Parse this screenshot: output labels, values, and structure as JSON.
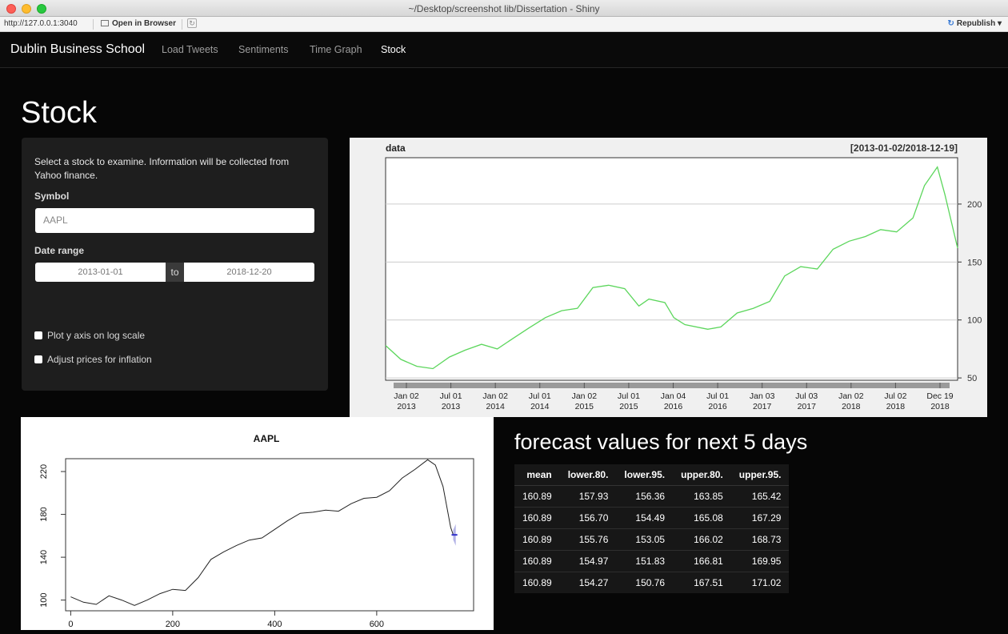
{
  "window": {
    "title": "~/Desktop/screenshot lib/Dissertation - Shiny",
    "url": "http://127.0.0.1:3040",
    "open_in_browser": "Open in Browser",
    "republish": "Republish"
  },
  "nav": {
    "brand": "Dublin Business School",
    "items": [
      "Load Tweets",
      "Sentiments",
      "Time Graph",
      "Stock"
    ],
    "active": "Stock"
  },
  "page": {
    "title": "Stock"
  },
  "sidebar": {
    "help_text": "Select a stock to examine. Information will be collected from Yahoo finance.",
    "symbol_label": "Symbol",
    "symbol_value": "AAPL",
    "date_label": "Date range",
    "date_from": "2013-01-01",
    "date_sep": "to",
    "date_to": "2018-12-20",
    "checkbox_log": "Plot y axis on log scale",
    "checkbox_inflation": "Adjust prices for inflation"
  },
  "colors": {
    "price_line": "#5cd65c",
    "forecast": "#3333cc",
    "forecast_band": "#b3b3e6"
  },
  "chart_data": [
    {
      "type": "line",
      "title": "data",
      "subtitle": "[2013-01-02/2018-12-19]",
      "x_ticks": [
        "Jan 02\n2013",
        "Jul 01\n2013",
        "Jan 02\n2014",
        "Jul 01\n2014",
        "Jan 02\n2015",
        "Jul 01\n2015",
        "Jan 04\n2016",
        "Jul 01\n2016",
        "Jan 03\n2017",
        "Jul 03\n2017",
        "Jan 02\n2018",
        "Jul 02\n2018",
        "Dec 19\n2018"
      ],
      "y_ticks": [
        50,
        100,
        150,
        200
      ],
      "ylim": [
        48,
        240
      ],
      "grid": true,
      "series": [
        {
          "x": [
            "2013-01-02",
            "2013-03-01",
            "2013-05-01",
            "2013-07-01",
            "2013-09-02",
            "2013-11-01",
            "2014-01-02",
            "2014-03-03",
            "2014-05-01",
            "2014-07-01",
            "2014-09-02",
            "2014-11-03",
            "2015-01-02",
            "2015-03-02",
            "2015-05-01",
            "2015-07-01",
            "2015-08-24",
            "2015-10-01",
            "2015-12-01",
            "2016-01-04",
            "2016-02-15",
            "2016-05-12",
            "2016-07-01",
            "2016-09-01",
            "2016-11-01",
            "2017-01-03",
            "2017-03-01",
            "2017-05-01",
            "2017-07-03",
            "2017-09-01",
            "2017-11-01",
            "2018-01-02",
            "2018-03-01",
            "2018-05-01",
            "2018-07-02",
            "2018-08-15",
            "2018-10-03",
            "2018-11-01",
            "2018-12-19"
          ],
          "y": [
            78,
            66,
            60,
            58,
            68,
            74,
            79,
            75,
            84,
            93,
            102,
            108,
            110,
            128,
            130,
            127,
            112,
            118,
            115,
            102,
            96,
            92,
            94,
            106,
            110,
            116,
            138,
            146,
            144,
            161,
            168,
            172,
            178,
            176,
            188,
            216,
            232,
            208,
            162
          ]
        }
      ]
    },
    {
      "type": "line",
      "title": "AAPL",
      "x_ticks": [
        0,
        200,
        400,
        600
      ],
      "y_ticks": [
        100,
        140,
        180,
        220
      ],
      "xlim": [
        -10,
        790
      ],
      "ylim": [
        90,
        232
      ],
      "series": [
        {
          "name": "",
          "x": [
            0,
            25,
            50,
            75,
            100,
            125,
            150,
            175,
            200,
            225,
            250,
            275,
            300,
            325,
            350,
            375,
            400,
            425,
            450,
            475,
            500,
            525,
            550,
            575,
            600,
            625,
            650,
            675,
            700,
            715,
            730,
            745,
            750
          ],
          "y": [
            103,
            98,
            96,
            104,
            100,
            95,
            100,
            106,
            110,
            109,
            121,
            138,
            145,
            151,
            156,
            158,
            166,
            174,
            181,
            182,
            184,
            183,
            190,
            195,
            196,
            202,
            214,
            222,
            231,
            226,
            206,
            168,
            161
          ]
        }
      ],
      "forecast": {
        "x": [
          750,
          755
        ],
        "mean": [
          160.89,
          160.89
        ],
        "lower95": [
          156.36,
          150.76
        ],
        "upper95": [
          165.42,
          171.02
        ]
      }
    }
  ],
  "forecast": {
    "title": "forecast values for next 5 days",
    "columns": [
      "mean",
      "lower.80.",
      "lower.95.",
      "upper.80.",
      "upper.95."
    ],
    "rows": [
      [
        "160.89",
        "157.93",
        "156.36",
        "163.85",
        "165.42"
      ],
      [
        "160.89",
        "156.70",
        "154.49",
        "165.08",
        "167.29"
      ],
      [
        "160.89",
        "155.76",
        "153.05",
        "166.02",
        "168.73"
      ],
      [
        "160.89",
        "154.97",
        "151.83",
        "166.81",
        "169.95"
      ],
      [
        "160.89",
        "154.27",
        "150.76",
        "167.51",
        "171.02"
      ]
    ]
  }
}
